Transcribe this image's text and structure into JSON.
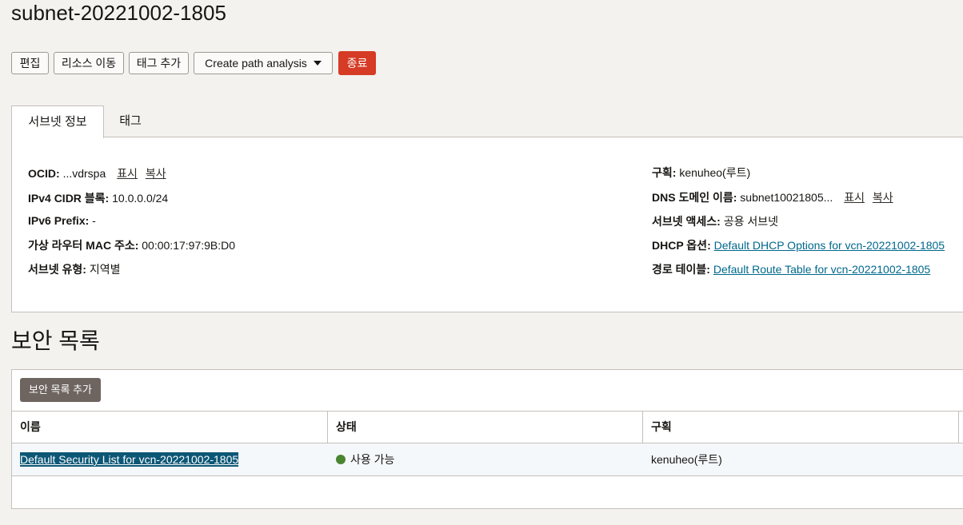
{
  "page": {
    "title": "subnet-20221002-1805"
  },
  "toolbar": {
    "edit": "편집",
    "move_resource": "리소스 이동",
    "add_tags": "태그 추가",
    "create_path_analysis": "Create path analysis",
    "terminate": "종료",
    "terminate_color": "#d63b25"
  },
  "tabs": [
    {
      "label": "서브넷 정보",
      "active": true
    },
    {
      "label": "태그",
      "active": false
    }
  ],
  "details": {
    "left": [
      {
        "label": "OCID:",
        "value": "...vdrspa",
        "actions": [
          "표시",
          "복사"
        ]
      },
      {
        "label": "IPv4 CIDR 블록:",
        "value": "10.0.0.0/24"
      },
      {
        "label": "IPv6 Prefix:",
        "value": "-"
      },
      {
        "label": "가상 라우터 MAC 주소:",
        "value": "00:00:17:97:9B:D0"
      },
      {
        "label": "서브넷 유형:",
        "value": "지역별"
      }
    ],
    "right": [
      {
        "label": "구획:",
        "value": "kenuheo(루트)"
      },
      {
        "label": "DNS 도메인 이름:",
        "value": "subnet10021805...",
        "actions": [
          "표시",
          "복사"
        ]
      },
      {
        "label": "서브넷 액세스:",
        "value": "공용 서브넷"
      },
      {
        "label": "DHCP 옵션:",
        "link": "Default DHCP Options for vcn-20221002-1805"
      },
      {
        "label": "경로 테이블:",
        "link": "Default Route Table for vcn-20221002-1805"
      }
    ]
  },
  "security_lists": {
    "heading": "보안 목록",
    "add_button": "보안 목록 추가",
    "columns": [
      "이름",
      "상태",
      "구획"
    ],
    "rows": [
      {
        "name": "Default Security List for vcn-20221002-1805",
        "status": "사용 가능",
        "status_color": "#4a8531",
        "compartment": "kenuheo(루트)"
      }
    ]
  }
}
